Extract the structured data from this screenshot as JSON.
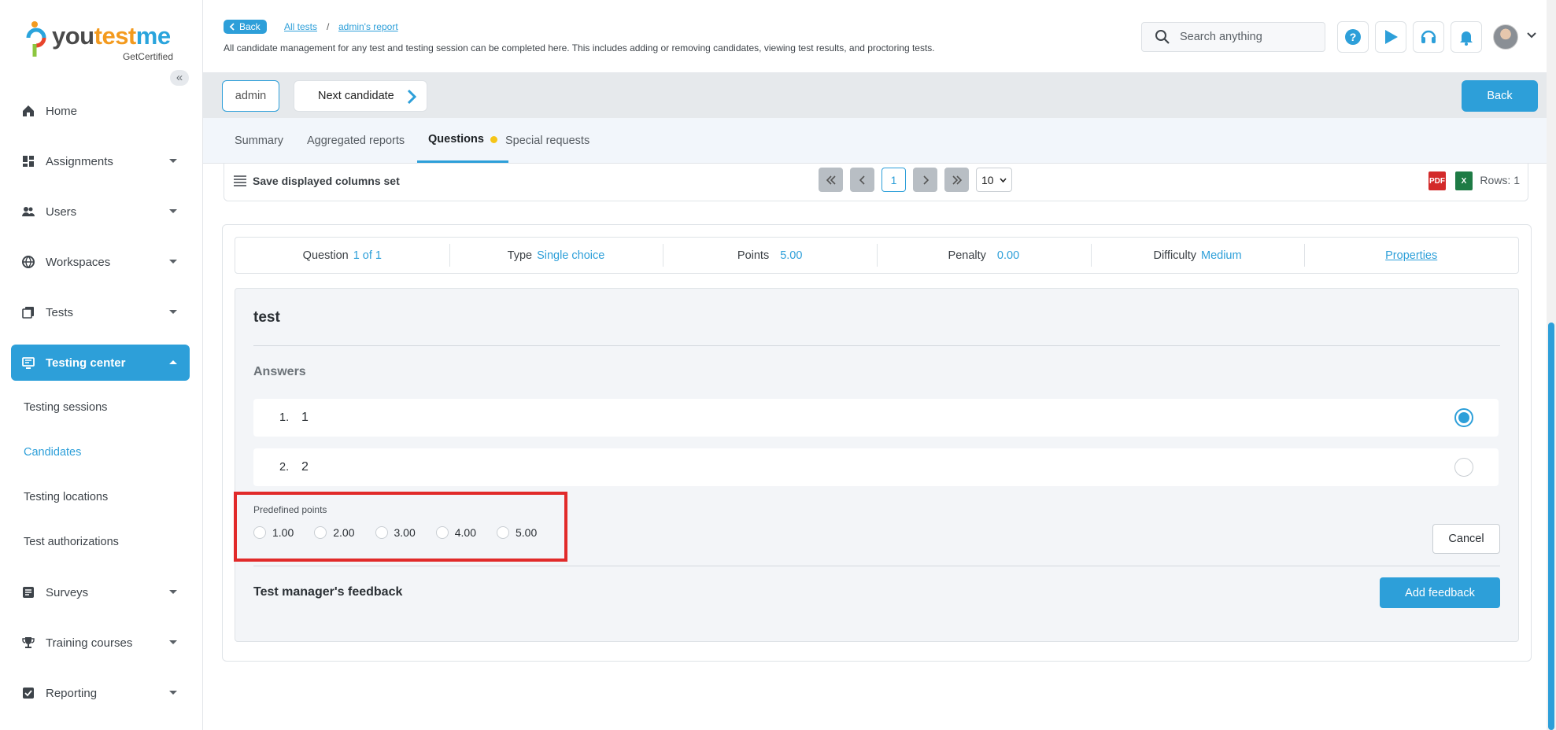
{
  "brand": {
    "name_you": "you",
    "name_test": "test",
    "name_me": "me",
    "sub": "GetCertified"
  },
  "sidebar": {
    "items": [
      {
        "label": "Home"
      },
      {
        "label": "Assignments"
      },
      {
        "label": "Users"
      },
      {
        "label": "Workspaces"
      },
      {
        "label": "Tests"
      },
      {
        "label": "Testing center"
      },
      {
        "label": "Surveys"
      },
      {
        "label": "Training courses"
      },
      {
        "label": "Reporting"
      }
    ],
    "sub_items": [
      {
        "label": "Testing sessions"
      },
      {
        "label": "Candidates"
      },
      {
        "label": "Testing locations"
      },
      {
        "label": "Test authorizations"
      }
    ]
  },
  "header": {
    "back_label": "Back",
    "crumbs": [
      "All tests",
      "admin's report"
    ],
    "separator": "/",
    "description": "All candidate management for any test and testing session can be completed here. This includes adding or removing candidates, viewing test results, and proctoring tests.",
    "search_placeholder": "Search anything"
  },
  "toolbar": {
    "candidate": "admin",
    "next_label": "Next candidate",
    "back_label": "Back"
  },
  "tabs": [
    {
      "label": "Summary"
    },
    {
      "label": "Aggregated reports"
    },
    {
      "label": "Questions"
    },
    {
      "label": "Special requests"
    }
  ],
  "table_bar": {
    "save_label": "Save displayed columns set",
    "current_page": "1",
    "rows_per_page": "10",
    "rows_label": "Rows: 1",
    "pdf_label": "PDF",
    "xls_label": "X"
  },
  "question": {
    "meta": {
      "question_label": "Question",
      "question_value": "1 of 1",
      "type_label": "Type",
      "type_value": "Single choice",
      "points_label": "Points",
      "points_value": "5.00",
      "penalty_label": "Penalty",
      "penalty_value": "0.00",
      "difficulty_label": "Difficulty",
      "difficulty_value": "Medium",
      "properties_label": "Properties"
    },
    "title": "test",
    "answers_label": "Answers",
    "answers": [
      {
        "num": "1.",
        "text": "1",
        "selected": true
      },
      {
        "num": "2.",
        "text": "2",
        "selected": false
      }
    ],
    "predefined_label": "Predefined points",
    "predefined_options": [
      "1.00",
      "2.00",
      "3.00",
      "4.00",
      "5.00"
    ],
    "cancel_label": "Cancel",
    "feedback_label": "Test manager's feedback",
    "add_feedback_label": "Add feedback"
  },
  "colors": {
    "accent": "#2d9fd9",
    "highlight": "#e12a2a",
    "tab_dot": "#f5c518"
  }
}
